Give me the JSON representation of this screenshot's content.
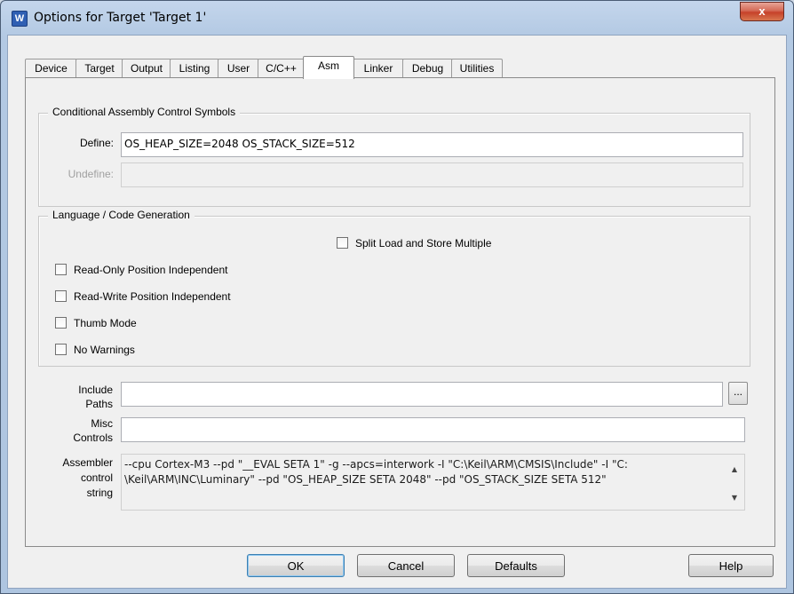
{
  "window": {
    "title": "Options for Target 'Target 1'",
    "close_glyph": "x",
    "app_icon": "W"
  },
  "tabs": [
    {
      "label": "Device"
    },
    {
      "label": "Target"
    },
    {
      "label": "Output"
    },
    {
      "label": "Listing"
    },
    {
      "label": "User"
    },
    {
      "label": "C/C++"
    },
    {
      "label": "Asm",
      "active": true
    },
    {
      "label": "Linker"
    },
    {
      "label": "Debug"
    },
    {
      "label": "Utilities"
    }
  ],
  "conditional": {
    "title": "Conditional Assembly Control Symbols",
    "define_label": "Define:",
    "define_value": "OS_HEAP_SIZE=2048 OS_STACK_SIZE=512",
    "undefine_label": "Undefine:",
    "undefine_value": ""
  },
  "language": {
    "title": "Language / Code Generation",
    "split_load": {
      "label": "Split Load and Store Multiple",
      "checked": false
    },
    "ropi": {
      "label": "Read-Only Position Independent",
      "checked": false
    },
    "rwpi": {
      "label": "Read-Write Position Independent",
      "checked": false
    },
    "thumb": {
      "label": "Thumb Mode",
      "checked": false
    },
    "no_warnings": {
      "label": "No Warnings",
      "checked": false
    }
  },
  "include": {
    "label_line1": "Include",
    "label_line2": "Paths",
    "value": "",
    "browse_label": "..."
  },
  "misc": {
    "label_line1": "Misc",
    "label_line2": "Controls",
    "value": ""
  },
  "asm_string": {
    "label_line1": "Assembler",
    "label_line2": "control",
    "label_line3": "string",
    "line1": "--cpu Cortex-M3 --pd \"__EVAL SETA 1\" -g --apcs=interwork -I \"C:\\Keil\\ARM\\CMSIS\\Include\" -I \"C:",
    "line2": "\\Keil\\ARM\\INC\\Luminary\" --pd \"OS_HEAP_SIZE SETA 2048\" --pd \"OS_STACK_SIZE SETA 512\""
  },
  "buttons": {
    "ok": "OK",
    "cancel": "Cancel",
    "defaults": "Defaults",
    "help": "Help"
  }
}
